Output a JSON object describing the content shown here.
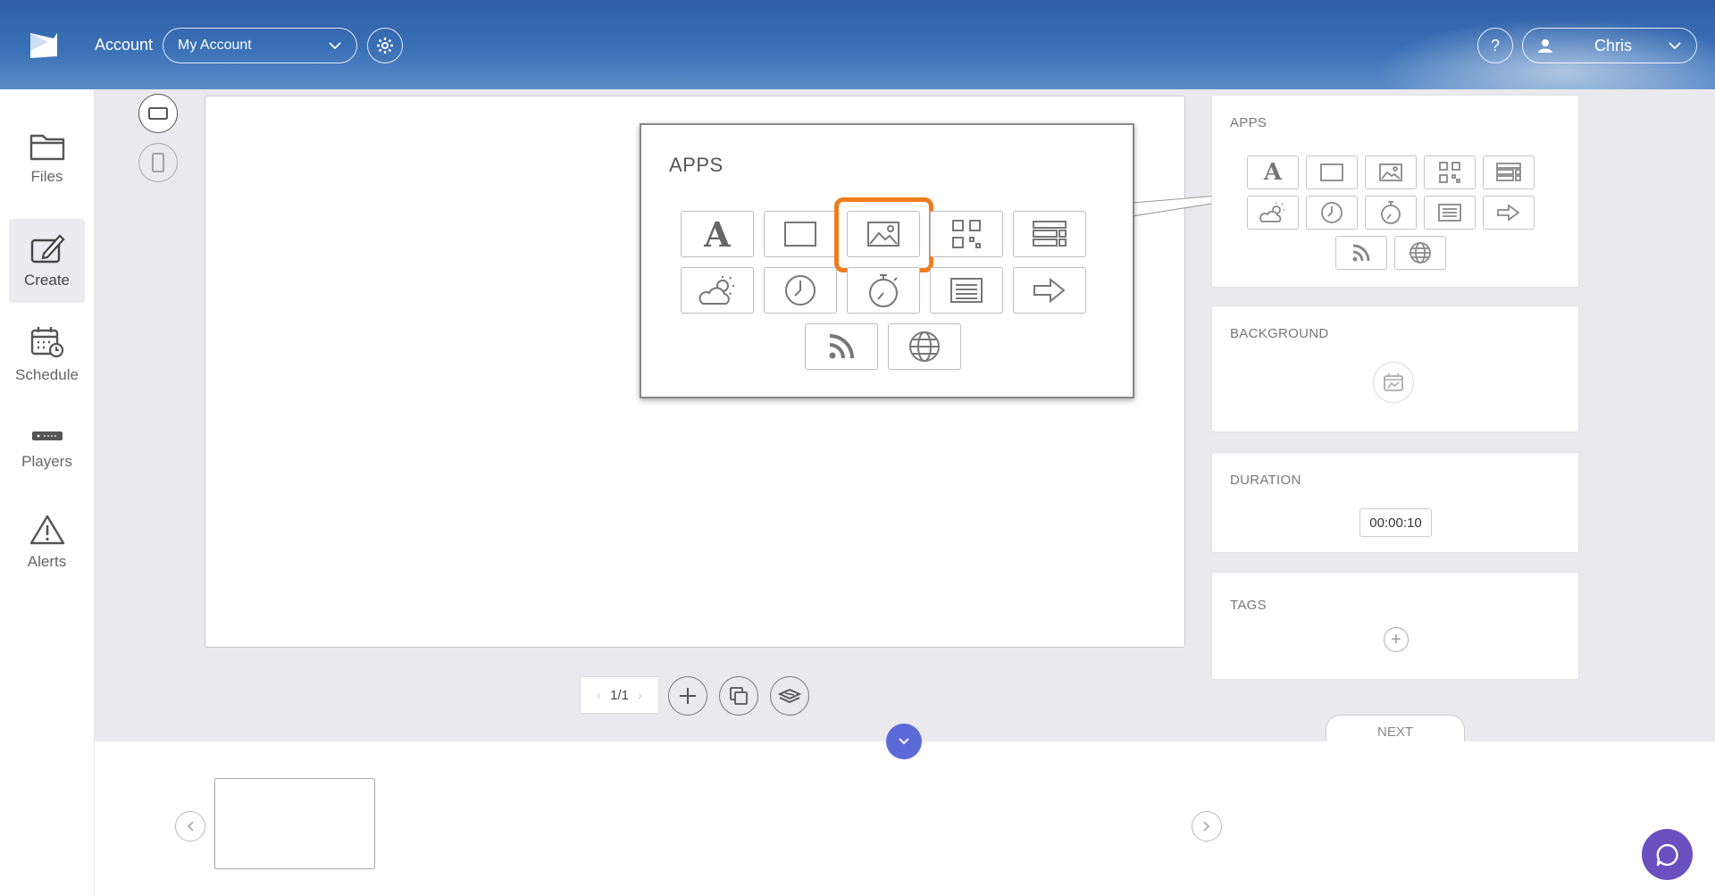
{
  "header": {
    "account_label": "Account",
    "account_value": "My Account",
    "help_label": "?",
    "user_name": "Chris"
  },
  "sidebar": {
    "items": [
      {
        "label": "Files",
        "icon": "folder-icon"
      },
      {
        "label": "Create",
        "icon": "create-icon",
        "active": true
      },
      {
        "label": "Schedule",
        "icon": "schedule-icon"
      },
      {
        "label": "Players",
        "icon": "player-icon"
      },
      {
        "label": "Alerts",
        "icon": "alert-icon"
      }
    ]
  },
  "apps_zoom": {
    "title": "APPS",
    "highlighted_app": "image-app"
  },
  "panel": {
    "apps_title": "APPS",
    "background_title": "BACKGROUND",
    "duration_title": "DURATION",
    "duration_value": "00:00:10",
    "tags_title": "TAGS",
    "next_label": "NEXT"
  },
  "apps": [
    "text-app",
    "rectangle-app",
    "image-app",
    "qr-code-app",
    "table-app",
    "weather-app",
    "clock-app",
    "countdown-app",
    "ticker-app",
    "arrow-app",
    "rss-app",
    "web-app"
  ],
  "pager": {
    "current": "1/1"
  },
  "colors": {
    "highlight": "#ef7d1e",
    "accent": "#5b6ad6",
    "chat": "#6a4fbf"
  }
}
